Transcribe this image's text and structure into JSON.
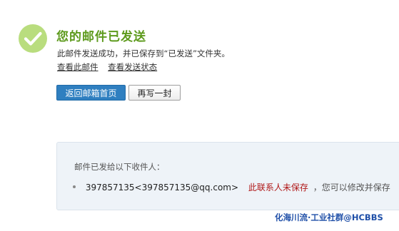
{
  "header": {
    "title": "您的邮件已发送",
    "subtitle": "此邮件发送成功，并已保存到“已发送”文件夹。"
  },
  "links": {
    "view_mail": "查看此邮件",
    "view_status": "查看发送状态"
  },
  "buttons": {
    "back_home": "返回邮箱首页",
    "write_another": "再写一封"
  },
  "recipients": {
    "heading": "邮件已发给以下收件人：",
    "items": [
      {
        "address": "397857135<397857135@qq.com>",
        "warning": "此联系人未保存",
        "hint": "，您可以修改并保存"
      }
    ]
  },
  "watermark": "化海川流·工业社群@HCBBS",
  "colors": {
    "success_green": "#5d9a1c",
    "primary_button": "#2f7fc0",
    "warning_red": "#b01818",
    "panel_bg": "#eef3f8"
  },
  "icons": {
    "status": "check-circle-icon"
  }
}
